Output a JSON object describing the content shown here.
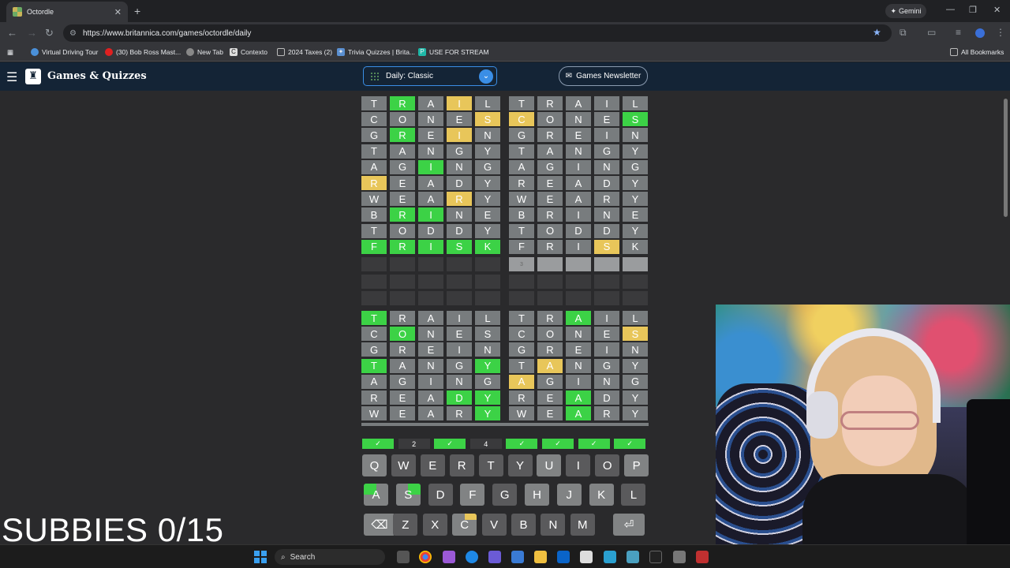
{
  "browser": {
    "tab_title": "Octordle",
    "new_tab": "+",
    "url": "https://www.britannica.com/games/octordle/daily",
    "gemini_label": "Gemini",
    "bookmarks": [
      "Virtual Driving Tour",
      "(30) Bob Ross Mast...",
      "New Tab",
      "Contexto",
      "2024 Taxes (2)",
      "Trivia Quizzes | Brita...",
      "USE FOR STREAM"
    ],
    "all_bookmarks": "All Bookmarks"
  },
  "site": {
    "name": "Games & Quizzes",
    "mode_select": "Daily: Classic",
    "newsletter": "Games Newsletter"
  },
  "boards": [
    {
      "rows": [
        [
          [
            "T",
            "n"
          ],
          [
            "R",
            "g"
          ],
          [
            "A",
            "n"
          ],
          [
            "I",
            "y"
          ],
          [
            "L",
            "n"
          ]
        ],
        [
          [
            "C",
            "n"
          ],
          [
            "O",
            "n"
          ],
          [
            "N",
            "n"
          ],
          [
            "E",
            "n"
          ],
          [
            "S",
            "y"
          ]
        ],
        [
          [
            "G",
            "n"
          ],
          [
            "R",
            "g"
          ],
          [
            "E",
            "n"
          ],
          [
            "I",
            "y"
          ],
          [
            "N",
            "n"
          ]
        ],
        [
          [
            "T",
            "n"
          ],
          [
            "A",
            "n"
          ],
          [
            "N",
            "n"
          ],
          [
            "G",
            "n"
          ],
          [
            "Y",
            "n"
          ]
        ],
        [
          [
            "A",
            "n"
          ],
          [
            "G",
            "n"
          ],
          [
            "I",
            "g"
          ],
          [
            "N",
            "n"
          ],
          [
            "G",
            "n"
          ]
        ],
        [
          [
            "R",
            "y"
          ],
          [
            "E",
            "n"
          ],
          [
            "A",
            "n"
          ],
          [
            "D",
            "n"
          ],
          [
            "Y",
            "n"
          ]
        ],
        [
          [
            "W",
            "n"
          ],
          [
            "E",
            "n"
          ],
          [
            "A",
            "n"
          ],
          [
            "R",
            "y"
          ],
          [
            "Y",
            "n"
          ]
        ],
        [
          [
            "B",
            "n"
          ],
          [
            "R",
            "g"
          ],
          [
            "I",
            "g"
          ],
          [
            "N",
            "n"
          ],
          [
            "E",
            "n"
          ]
        ],
        [
          [
            "T",
            "n"
          ],
          [
            "O",
            "n"
          ],
          [
            "D",
            "n"
          ],
          [
            "D",
            "n"
          ],
          [
            "Y",
            "n"
          ]
        ],
        [
          [
            "F",
            "g"
          ],
          [
            "R",
            "g"
          ],
          [
            "I",
            "g"
          ],
          [
            "S",
            "g"
          ],
          [
            "K",
            "g"
          ]
        ]
      ]
    },
    {
      "rows": [
        [
          [
            "T",
            "n"
          ],
          [
            "R",
            "n"
          ],
          [
            "A",
            "n"
          ],
          [
            "I",
            "n"
          ],
          [
            "L",
            "n"
          ]
        ],
        [
          [
            "C",
            "y"
          ],
          [
            "O",
            "n"
          ],
          [
            "N",
            "n"
          ],
          [
            "E",
            "n"
          ],
          [
            "S",
            "g"
          ]
        ],
        [
          [
            "G",
            "n"
          ],
          [
            "R",
            "n"
          ],
          [
            "E",
            "n"
          ],
          [
            "I",
            "n"
          ],
          [
            "N",
            "n"
          ]
        ],
        [
          [
            "T",
            "n"
          ],
          [
            "A",
            "n"
          ],
          [
            "N",
            "n"
          ],
          [
            "G",
            "n"
          ],
          [
            "Y",
            "n"
          ]
        ],
        [
          [
            "A",
            "n"
          ],
          [
            "G",
            "n"
          ],
          [
            "I",
            "n"
          ],
          [
            "N",
            "n"
          ],
          [
            "G",
            "n"
          ]
        ],
        [
          [
            "R",
            "n"
          ],
          [
            "E",
            "n"
          ],
          [
            "A",
            "n"
          ],
          [
            "D",
            "n"
          ],
          [
            "Y",
            "n"
          ]
        ],
        [
          [
            "W",
            "n"
          ],
          [
            "E",
            "n"
          ],
          [
            "A",
            "n"
          ],
          [
            "R",
            "n"
          ],
          [
            "Y",
            "n"
          ]
        ],
        [
          [
            "B",
            "n"
          ],
          [
            "R",
            "n"
          ],
          [
            "I",
            "n"
          ],
          [
            "N",
            "n"
          ],
          [
            "E",
            "n"
          ]
        ],
        [
          [
            "T",
            "n"
          ],
          [
            "O",
            "n"
          ],
          [
            "D",
            "n"
          ],
          [
            "D",
            "n"
          ],
          [
            "Y",
            "n"
          ]
        ],
        [
          [
            "F",
            "n"
          ],
          [
            "R",
            "n"
          ],
          [
            "I",
            "n"
          ],
          [
            "S",
            "y"
          ],
          [
            "K",
            "n"
          ]
        ]
      ]
    },
    {
      "rows": [
        [
          [
            "T",
            "g"
          ],
          [
            "R",
            "n"
          ],
          [
            "A",
            "n"
          ],
          [
            "I",
            "n"
          ],
          [
            "L",
            "n"
          ]
        ],
        [
          [
            "C",
            "n"
          ],
          [
            "O",
            "g"
          ],
          [
            "N",
            "n"
          ],
          [
            "E",
            "n"
          ],
          [
            "S",
            "n"
          ]
        ],
        [
          [
            "G",
            "n"
          ],
          [
            "R",
            "n"
          ],
          [
            "E",
            "n"
          ],
          [
            "I",
            "n"
          ],
          [
            "N",
            "n"
          ]
        ],
        [
          [
            "T",
            "g"
          ],
          [
            "A",
            "n"
          ],
          [
            "N",
            "n"
          ],
          [
            "G",
            "n"
          ],
          [
            "Y",
            "g"
          ]
        ],
        [
          [
            "A",
            "n"
          ],
          [
            "G",
            "n"
          ],
          [
            "I",
            "n"
          ],
          [
            "N",
            "n"
          ],
          [
            "G",
            "n"
          ]
        ],
        [
          [
            "R",
            "n"
          ],
          [
            "E",
            "n"
          ],
          [
            "A",
            "n"
          ],
          [
            "D",
            "g"
          ],
          [
            "Y",
            "g"
          ]
        ],
        [
          [
            "W",
            "n"
          ],
          [
            "E",
            "n"
          ],
          [
            "A",
            "n"
          ],
          [
            "R",
            "n"
          ],
          [
            "Y",
            "g"
          ]
        ]
      ]
    },
    {
      "rows": [
        [
          [
            "T",
            "n"
          ],
          [
            "R",
            "n"
          ],
          [
            "A",
            "g"
          ],
          [
            "I",
            "n"
          ],
          [
            "L",
            "n"
          ]
        ],
        [
          [
            "C",
            "n"
          ],
          [
            "O",
            "n"
          ],
          [
            "N",
            "n"
          ],
          [
            "E",
            "n"
          ],
          [
            "S",
            "y"
          ]
        ],
        [
          [
            "G",
            "n"
          ],
          [
            "R",
            "n"
          ],
          [
            "E",
            "n"
          ],
          [
            "I",
            "n"
          ],
          [
            "N",
            "n"
          ]
        ],
        [
          [
            "T",
            "n"
          ],
          [
            "A",
            "y"
          ],
          [
            "N",
            "n"
          ],
          [
            "G",
            "n"
          ],
          [
            "Y",
            "n"
          ]
        ],
        [
          [
            "A",
            "y"
          ],
          [
            "G",
            "n"
          ],
          [
            "I",
            "n"
          ],
          [
            "N",
            "n"
          ],
          [
            "G",
            "n"
          ]
        ],
        [
          [
            "R",
            "n"
          ],
          [
            "E",
            "n"
          ],
          [
            "A",
            "g"
          ],
          [
            "D",
            "n"
          ],
          [
            "Y",
            "n"
          ]
        ],
        [
          [
            "W",
            "n"
          ],
          [
            "E",
            "n"
          ],
          [
            "A",
            "g"
          ],
          [
            "R",
            "n"
          ],
          [
            "Y",
            "n"
          ]
        ]
      ]
    }
  ],
  "current_input_hint": "3",
  "board_status": [
    "✓",
    "2",
    "✓",
    "4",
    "✓",
    "✓",
    "✓",
    "✓"
  ],
  "keyboard": {
    "row1": [
      "Q",
      "W",
      "E",
      "R",
      "T",
      "Y",
      "U",
      "I",
      "O",
      "P"
    ],
    "row2": [
      "A",
      "S",
      "D",
      "F",
      "G",
      "H",
      "J",
      "K",
      "L"
    ],
    "row3": [
      "⌫",
      "Z",
      "X",
      "C",
      "V",
      "B",
      "N",
      "M",
      "⏎"
    ]
  },
  "overlay_text": "SUBBIES 0/15",
  "taskbar": {
    "search": "Search"
  },
  "colors": {
    "green": "#3cd246",
    "yellow": "#e8c65a",
    "gray": "#787c7e",
    "header": "#142436"
  }
}
